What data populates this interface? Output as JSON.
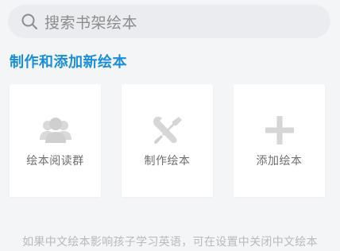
{
  "search": {
    "placeholder": "搜索书架绘本",
    "icon": "search-icon"
  },
  "section": {
    "title": "制作和添加新绘本"
  },
  "cards": [
    {
      "label": "绘本阅读群",
      "icon": "group-users-icon"
    },
    {
      "label": "制作绘本",
      "icon": "tools-icon"
    },
    {
      "label": "添加绘本",
      "icon": "plus-icon"
    }
  ],
  "footer": {
    "note": "如果中文绘本影响孩子学习英语，可在设置中关闭中文绘本"
  },
  "colors": {
    "accent": "#1a8ed6",
    "icon_gray": "#d9d9d9",
    "background": "#f4f5f7"
  }
}
